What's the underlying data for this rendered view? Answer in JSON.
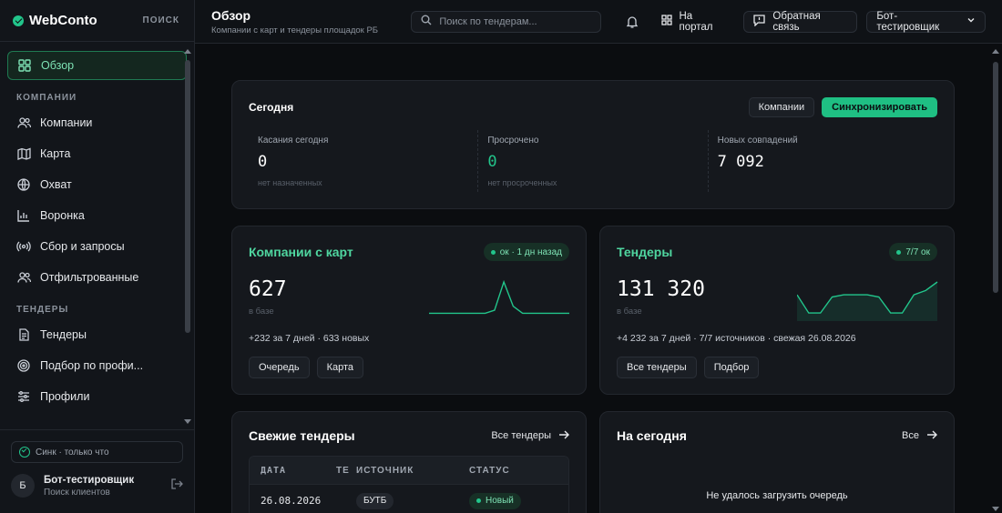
{
  "brand": {
    "name": "WebConto",
    "search_label": "ПОИСК"
  },
  "sidebar": {
    "items": [
      {
        "label": "Обзор",
        "icon": "grid-icon",
        "active": true
      },
      {
        "section": "КОМПАНИИ"
      },
      {
        "label": "Компании",
        "icon": "users-icon"
      },
      {
        "label": "Карта",
        "icon": "map-icon"
      },
      {
        "label": "Охват",
        "icon": "globe-icon"
      },
      {
        "label": "Воронка",
        "icon": "bar-chart-icon"
      },
      {
        "label": "Сбор и запросы",
        "icon": "broadcast-icon"
      },
      {
        "label": "Отфильтрованные",
        "icon": "users-icon"
      },
      {
        "section": "ТЕНДЕРЫ"
      },
      {
        "label": "Тендеры",
        "icon": "document-icon"
      },
      {
        "label": "Подбор по профи...",
        "icon": "target-icon"
      },
      {
        "label": "Профили",
        "icon": "sliders-icon"
      }
    ],
    "sync": "Синк · только что",
    "user": {
      "initial": "Б",
      "name": "Бот-тестировщик",
      "role": "Поиск клиентов"
    }
  },
  "topbar": {
    "title": "Обзор",
    "subtitle": "Компании с карт и тендеры площадок РБ",
    "search_placeholder": "Поиск по тендерам...",
    "portal_label": "На портал",
    "feedback_label": "Обратная связь",
    "user_label": "Бот-тестировщик"
  },
  "today": {
    "title": "Сегодня",
    "btn_companies": "Компании",
    "btn_sync": "Синхронизировать",
    "stats": [
      {
        "label": "Касания сегодня",
        "value": "0",
        "sub": "нет назначенных"
      },
      {
        "label": "Просрочено",
        "value": "0",
        "sub": "нет просроченных"
      },
      {
        "label": "Новых совпадений",
        "value": "7 092",
        "sub": ""
      }
    ]
  },
  "companies_card": {
    "title": "Компании с карт",
    "badge": "ок · 1 дн назад",
    "value": "627",
    "value_sub": "в базе",
    "meta": "+232 за 7 дней · 633 новых",
    "btn1": "Очередь",
    "btn2": "Карта",
    "spark": [
      5,
      5,
      5,
      5,
      5,
      5,
      5,
      8,
      36,
      12,
      5,
      5,
      5,
      5,
      5,
      5
    ]
  },
  "tenders_card": {
    "title": "Тендеры",
    "badge": "7/7 ок",
    "value": "131 320",
    "value_sub": "в базе",
    "meta": "+4 232 за 7 дней · 7/7 источников · свежая 26.08.2026",
    "btn1": "Все тендеры",
    "btn2": "Подбор",
    "spark": [
      22,
      5,
      5,
      20,
      22,
      22,
      22,
      20,
      5,
      5,
      22,
      26,
      34
    ]
  },
  "fresh_tenders": {
    "title": "Свежие тендеры",
    "link": "Все тендеры",
    "columns": [
      "ДАТА",
      "ТЕ",
      "ИСТОЧНИК",
      "СТАТУС"
    ],
    "rows": [
      {
        "date": "26.08.2026",
        "te": "",
        "source": "БУТБ",
        "status": "Новый"
      }
    ]
  },
  "on_today": {
    "title": "На сегодня",
    "link": "Все",
    "message": "Не удалось загрузить очередь"
  },
  "colors": {
    "accent": "#22c58b",
    "accent_bg": "#14271f",
    "bg": "#0b0d10",
    "card": "#15181d"
  }
}
